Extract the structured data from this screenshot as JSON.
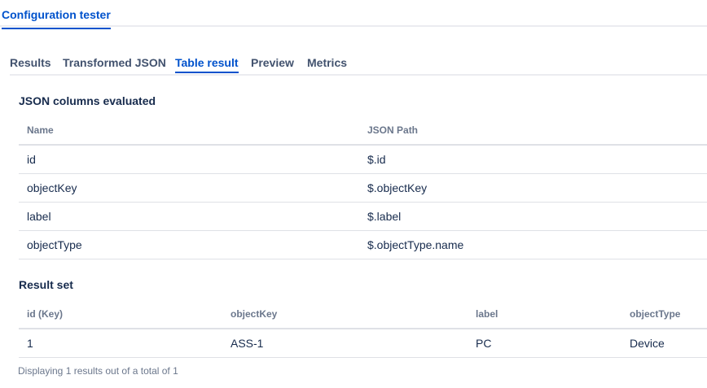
{
  "top_tabs": [
    {
      "label": "Configuration tester"
    }
  ],
  "sub_tabs": [
    {
      "label": "Results"
    },
    {
      "label": "Transformed JSON"
    },
    {
      "label": "Table result"
    },
    {
      "label": "Preview"
    },
    {
      "label": "Metrics"
    }
  ],
  "json_columns": {
    "title": "JSON columns evaluated",
    "headers": [
      "Name",
      "JSON Path"
    ],
    "rows": [
      [
        "id",
        "$.id"
      ],
      [
        "objectKey",
        "$.objectKey"
      ],
      [
        "label",
        "$.label"
      ],
      [
        "objectType",
        "$.objectType.name"
      ]
    ]
  },
  "result_set": {
    "title": "Result set",
    "headers": [
      "id (Key)",
      "objectKey",
      "label",
      "objectType"
    ],
    "rows": [
      [
        "1",
        "ASS-1",
        "PC",
        "Device"
      ]
    ],
    "footer": "Displaying 1 results out of a total of 1"
  }
}
